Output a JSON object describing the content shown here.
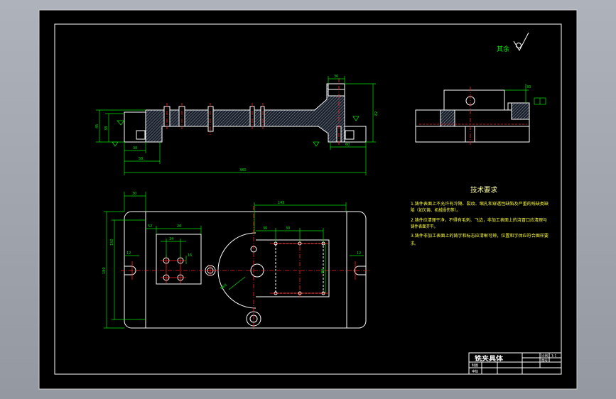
{
  "colors": {
    "viewer_background": "#9ea2aa",
    "canvas": "#000000",
    "outline": "#ffffff",
    "dimension": "#00e600",
    "centerline": "#ff2020",
    "text": "#ffff40"
  },
  "roughness": {
    "label": "其余"
  },
  "tech_req": {
    "title": "技术要求",
    "items": [
      {
        "lines": [
          "1.铸件表面上不允许有冷隔、裂纹、缩孔和穿透性缺陷及严重的残缺类缺",
          "陷（如欠铸、机械损伤等）。"
        ]
      },
      {
        "lines": [
          "2.铸件应清理干净，不得有毛刺、飞边，非加工表面上的浇冒口应清理与",
          "铸件表面齐平。"
        ]
      },
      {
        "lines": [
          "3.铸件非加工表面上的铸字和标志应清晰可辨，位置和字体应符合图样要",
          "求。"
        ]
      }
    ]
  },
  "title_block": {
    "name": "铣夹具体",
    "scale_label": "比例",
    "scale": "1:1",
    "drawing_no_label": "图号",
    "drawn_label": "制图",
    "checked_label": "审核"
  },
  "dimensions": {
    "side": {
      "overall_length": "380",
      "left_step": "58",
      "left_base": "30",
      "height_outer": "45",
      "height_inner": "38",
      "top_block": "30",
      "right_base": "60",
      "right_height": "82"
    },
    "top": {
      "left_edge": "30",
      "slot_width": "145",
      "block_offset": "52",
      "block_width": "20",
      "hole_spacing": "34",
      "hole_pitch": "16",
      "outer_height": "180",
      "inner_height": "150",
      "slot_left": "12",
      "slot_right": "12",
      "pitch_a": "36",
      "pitch_b": "30",
      "arc_radius": "R60",
      "pocket_height": "80"
    },
    "right": {
      "top_height": "30"
    }
  }
}
